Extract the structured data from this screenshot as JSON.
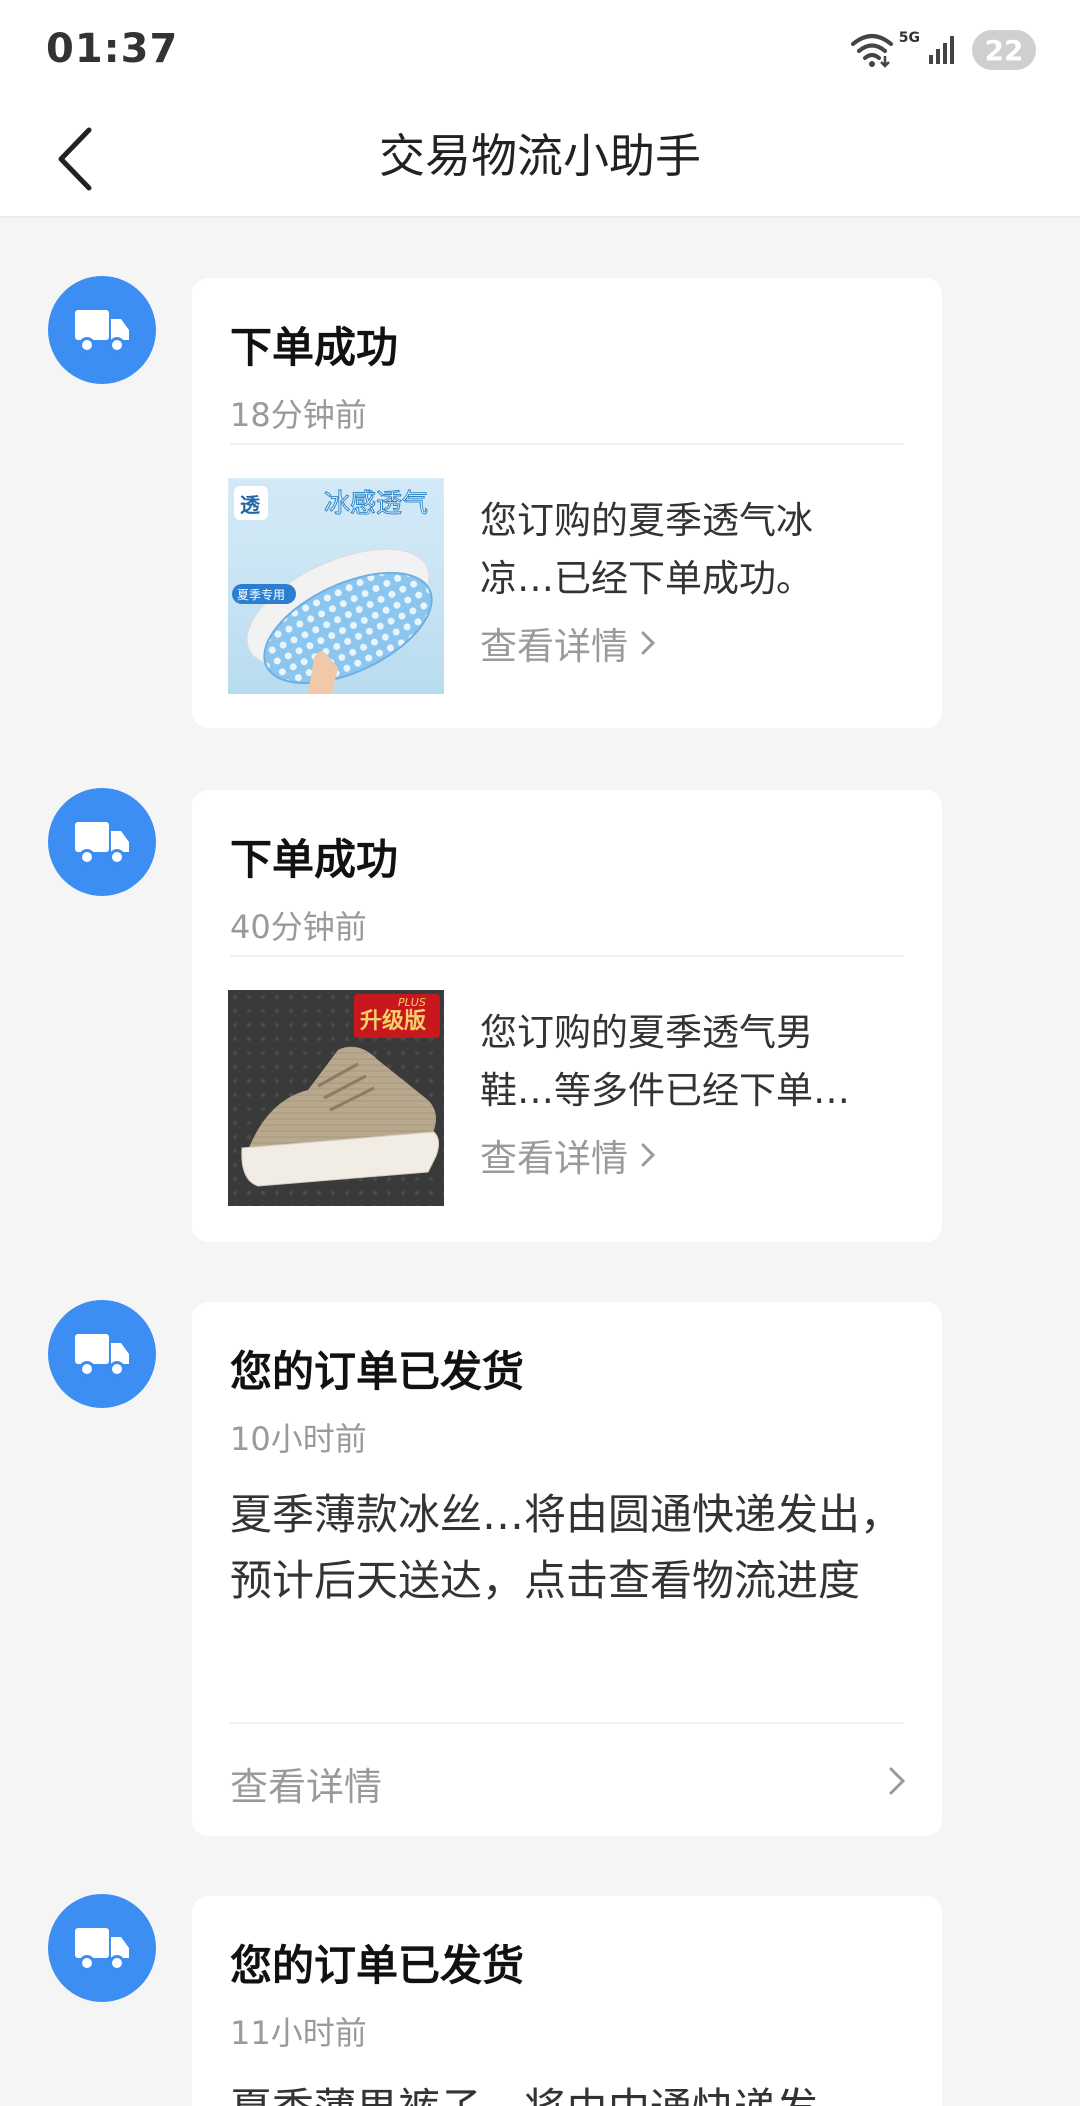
{
  "status_bar": {
    "time": "01:37",
    "network": "5G",
    "battery": "22"
  },
  "header": {
    "title": "交易物流小助手"
  },
  "messages": [
    {
      "title": "下单成功",
      "time": "18分钟前",
      "thumb_caption": "冰感透气",
      "thumb_badge": "透",
      "thumb_tag": "夏季专用",
      "description": "您订购的夏季透气冰凉…已经下单成功。",
      "link": "查看详情"
    },
    {
      "title": "下单成功",
      "time": "40分钟前",
      "thumb_badge": "升级版",
      "thumb_tag": "PLUS",
      "description": "您订购的夏季透气男鞋…等多件已经下单…",
      "link": "查看详情"
    },
    {
      "title": "您的订单已发货",
      "time": "10小时前",
      "description": "夏季薄款冰丝…将由圆通快递发出，预计后天送达，点击查看物流进度",
      "link": "查看详情"
    },
    {
      "title": "您的订单已发货",
      "time": "11小时前",
      "description": "夏季薄男裤子…将由中通快递发"
    }
  ],
  "icons": {
    "back": "chevron-left-icon",
    "avatar": "truck-icon",
    "link_arrow": "chevron-right-icon",
    "wifi": "wifi-icon",
    "signal": "signal-icon"
  },
  "colors": {
    "accent": "#3d8ef3",
    "background": "#f5f5f5",
    "muted_text": "#9a9a9a"
  }
}
